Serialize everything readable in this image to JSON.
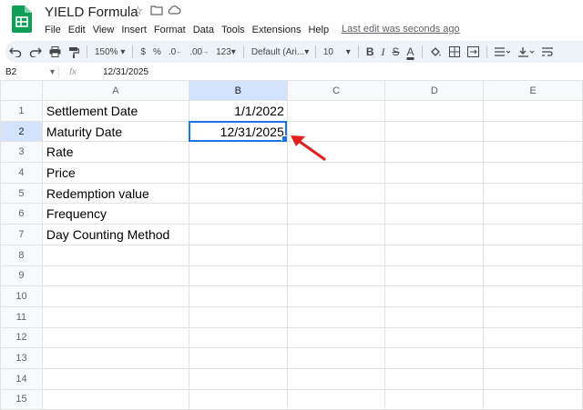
{
  "document": {
    "title": "YIELD Formula",
    "last_edit": "Last edit was seconds ago"
  },
  "menu": [
    "File",
    "Edit",
    "View",
    "Insert",
    "Format",
    "Data",
    "Tools",
    "Extensions",
    "Help"
  ],
  "toolbar": {
    "zoom": "150%",
    "currency": "$",
    "percent": "%",
    "decrease_decimals": ".0",
    "increase_decimals": ".00",
    "more_formats": "123",
    "font": "Default (Ari...",
    "font_size": "10",
    "bold": "B",
    "italic": "I",
    "strikethrough": "S",
    "text_color": "A"
  },
  "formula_bar": {
    "cell_ref": "B2",
    "fx": "fx",
    "value": "12/31/2025"
  },
  "columns": [
    "A",
    "B",
    "C",
    "D",
    "E"
  ],
  "rows": [
    {
      "num": "1",
      "a": "Settlement Date",
      "b": "1/1/2022"
    },
    {
      "num": "2",
      "a": "Maturity Date",
      "b": "12/31/2025"
    },
    {
      "num": "3",
      "a": "Rate",
      "b": ""
    },
    {
      "num": "4",
      "a": "Price",
      "b": ""
    },
    {
      "num": "5",
      "a": "Redemption value",
      "b": ""
    },
    {
      "num": "6",
      "a": "Frequency",
      "b": ""
    },
    {
      "num": "7",
      "a": "Day Counting Method",
      "b": ""
    },
    {
      "num": "8",
      "a": "",
      "b": ""
    },
    {
      "num": "9",
      "a": "",
      "b": ""
    },
    {
      "num": "10",
      "a": "",
      "b": ""
    },
    {
      "num": "11",
      "a": "",
      "b": ""
    },
    {
      "num": "12",
      "a": "",
      "b": ""
    },
    {
      "num": "13",
      "a": "",
      "b": ""
    },
    {
      "num": "14",
      "a": "",
      "b": ""
    },
    {
      "num": "15",
      "a": "",
      "b": ""
    }
  ],
  "colors": {
    "selection": "#1a73e8",
    "arrow": "#e02020",
    "sheets_green": "#0f9d58"
  }
}
